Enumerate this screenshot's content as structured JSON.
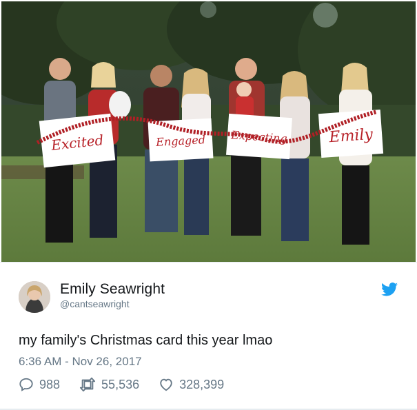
{
  "tweet": {
    "author": {
      "display_name": "Emily Seawright",
      "handle": "@cantseawright"
    },
    "text": "my family's Christmas card this year lmao",
    "timestamp": "6:36 AM - Nov 26, 2017",
    "stats": {
      "replies": "988",
      "retweets": "55,536",
      "likes": "328,399"
    },
    "icons": {
      "brand": "twitter-bird-icon",
      "reply": "reply-icon",
      "retweet": "retweet-icon",
      "like": "heart-icon"
    },
    "colors": {
      "brand_blue": "#1da1f2",
      "text_primary": "#14171a",
      "text_secondary": "#657786"
    }
  },
  "photo": {
    "signs": [
      "Excited",
      "Engaged",
      "Expecting",
      "Emily"
    ]
  }
}
